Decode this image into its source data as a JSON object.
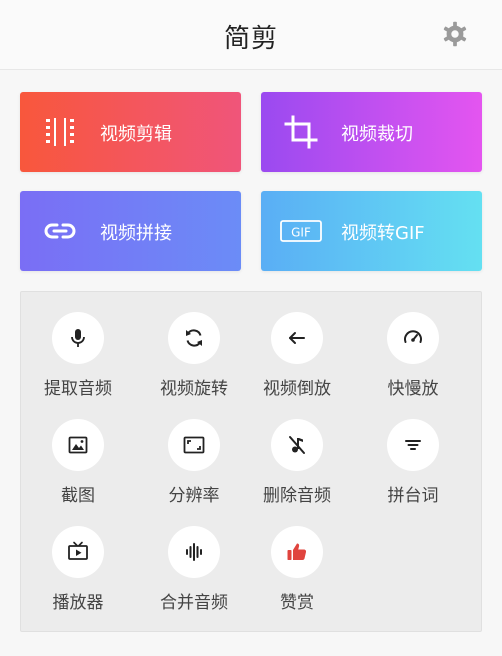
{
  "header": {
    "title": "简剪",
    "settings_icon": "gear-icon"
  },
  "cards": [
    {
      "label": "视频剪辑",
      "icon": "film-cut-icon",
      "gradient": [
        "#f8573c",
        "#f0557a"
      ]
    },
    {
      "label": "视频裁切",
      "icon": "crop-icon",
      "gradient": [
        "#9a4af0",
        "#e455f0"
      ]
    },
    {
      "label": "视频拼接",
      "icon": "link-icon",
      "gradient": [
        "#7a6ef5",
        "#6b8cf7"
      ]
    },
    {
      "label": "视频转GIF",
      "icon": "gif-icon",
      "gradient": [
        "#5aaef5",
        "#64e0f2"
      ]
    }
  ],
  "tools": [
    {
      "label": "提取音频",
      "icon": "mic-icon"
    },
    {
      "label": "视频旋转",
      "icon": "rotate-icon"
    },
    {
      "label": "视频倒放",
      "icon": "arrow-left-icon"
    },
    {
      "label": "快慢放",
      "icon": "speed-gauge-icon"
    },
    {
      "label": "截图",
      "icon": "image-icon"
    },
    {
      "label": "分辨率",
      "icon": "resolution-icon"
    },
    {
      "label": "删除音频",
      "icon": "mute-music-icon"
    },
    {
      "label": "拼台词",
      "icon": "subtitles-icon"
    },
    {
      "label": "播放器",
      "icon": "tv-play-icon"
    },
    {
      "label": "合并音频",
      "icon": "waveform-icon"
    },
    {
      "label": "赞赏",
      "icon": "thumbs-up-icon",
      "accent": "#e0443e"
    }
  ]
}
